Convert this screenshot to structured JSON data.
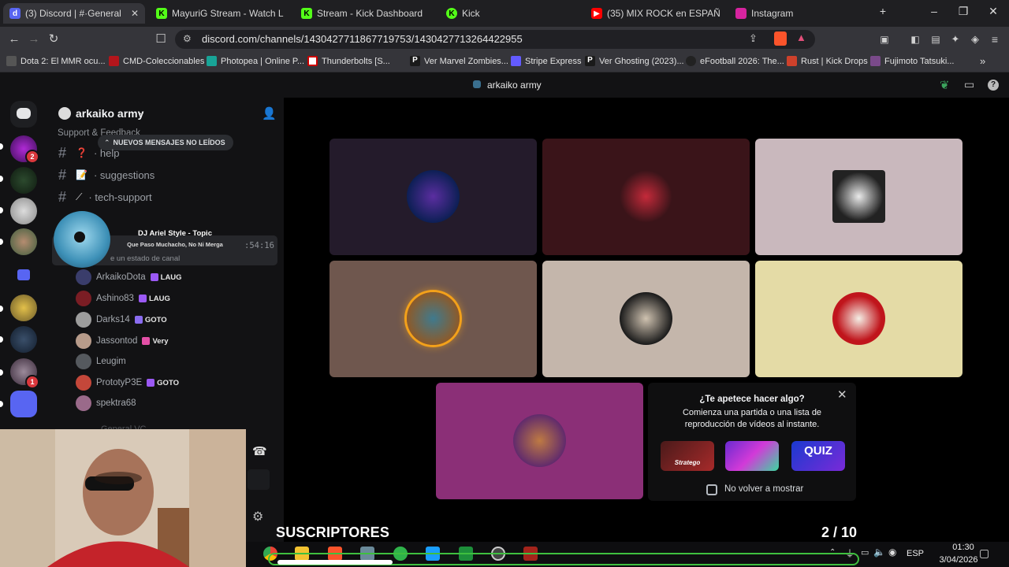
{
  "browser": {
    "tabs": [
      {
        "label": "(3) Discord | #·General",
        "active": true
      },
      {
        "label": "MayuriG Stream - Watch Live"
      },
      {
        "label": "Stream - Kick Dashboard"
      },
      {
        "label": "Kick"
      },
      {
        "label": "(35) MIX ROCK en ESPAÑ"
      },
      {
        "label": "Instagram"
      }
    ],
    "url": "discord.com/channels/1430427711867719753/1430427713264422955",
    "bookmarks": [
      "Dota 2: El MMR ocu...",
      "CMD-Coleccionables",
      "Photopea | Online P...",
      "Thunderbolts [S...",
      "Ver Marvel Zombies...",
      "Stripe Express",
      "Ver Ghosting (2023)...",
      "eFootball 2026: The...",
      "Rust | Kick Drops",
      "Fujimoto Tatsuki..."
    ]
  },
  "discord": {
    "window_title": "arkaiko army",
    "server_name": "arkaiko army",
    "category": "Support & Feedback",
    "new_messages_pill": "NUEVOS MENSAJES NO LEÍDOS",
    "channels": [
      {
        "emoji": "❓",
        "name": "· help"
      },
      {
        "emoji": "📝",
        "name": "· suggestions"
      },
      {
        "emoji": "⟋",
        "name": "· tech-support"
      }
    ],
    "now_playing": {
      "title": "DJ Ariel Style - Topic",
      "subtitle": "Que Paso Muchacho, No Ni Merga",
      "timer": ":54:16",
      "status_hint": "e un estado de canal"
    },
    "voice_members": [
      {
        "name": "ArkaikoDota",
        "tag": "LAUG"
      },
      {
        "name": "Ashino83",
        "tag": "LAUG"
      },
      {
        "name": "Darks14",
        "tag": "GOTO"
      },
      {
        "name": "Jassontod",
        "tag": "Very"
      },
      {
        "name": "Leugim",
        "tag": ""
      },
      {
        "name": "PrototyP3E",
        "tag": "GOTO"
      },
      {
        "name": "spektra68",
        "tag": ""
      }
    ],
    "next_channel_partial": "General VC",
    "server_badges": [
      "2",
      "1"
    ],
    "activity_popup": {
      "title": "¿Te apetece hacer algo?",
      "body": "Comienza una partida o una lista de reproducción de vídeos al instante.",
      "activities": [
        "Stratego",
        "",
        "QUIZ"
      ],
      "checkbox_label": "No volver a mostrar"
    },
    "grid_tiles": [
      {
        "bg": "#241b2b"
      },
      {
        "bg": "#3a1419"
      },
      {
        "bg": "#c9b8bd"
      },
      {
        "bg": "#6f574e"
      },
      {
        "bg": "#c4b6ab"
      },
      {
        "bg": "#e4dba6"
      },
      {
        "bg": "#8b2f77"
      }
    ]
  },
  "overlay": {
    "label": "SUSCRIPTORES",
    "count": "2 / 10"
  },
  "taskbar": {
    "language": "ESP",
    "time": "01:30",
    "date": "3/04/2026"
  }
}
